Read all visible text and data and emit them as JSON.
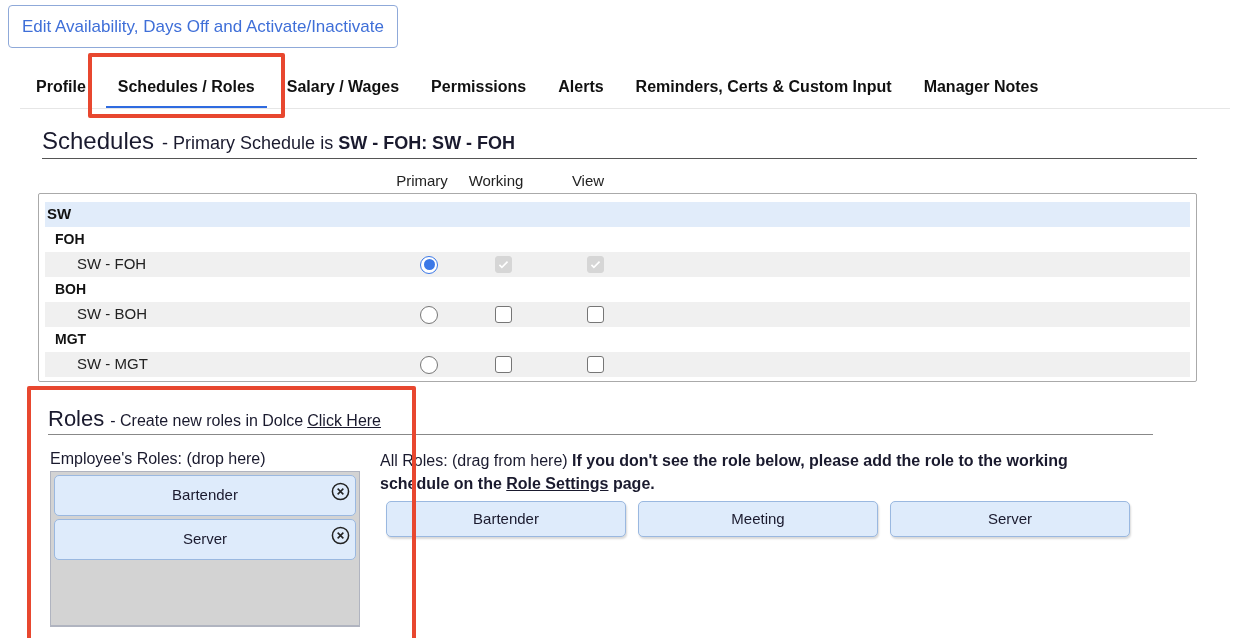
{
  "top_button": "Edit Availability, Days Off and Activate/Inactivate",
  "tabs": [
    {
      "label": "Profile",
      "selected": false,
      "highlighted": false
    },
    {
      "label": "Schedules / Roles",
      "selected": true,
      "highlighted": true
    },
    {
      "label": "Salary / Wages",
      "selected": false,
      "highlighted": false
    },
    {
      "label": "Permissions",
      "selected": false,
      "highlighted": false
    },
    {
      "label": "Alerts",
      "selected": false,
      "highlighted": false
    },
    {
      "label": "Reminders, Certs & Custom Input",
      "selected": false,
      "highlighted": false
    },
    {
      "label": "Manager Notes",
      "selected": false,
      "highlighted": false
    }
  ],
  "schedules": {
    "title": "Schedules",
    "subtitle": "- Primary Schedule is **SW - FOH: SW - FOH**",
    "columns": [
      "Primary",
      "Working",
      "View"
    ],
    "groups": [
      {
        "name": "SW",
        "children": [
          {
            "name": "FOH",
            "children": [
              {
                "name": "SW - FOH",
                "primary": true,
                "working": true,
                "view": true,
                "disabled": true
              }
            ]
          },
          {
            "name": "BOH",
            "children": [
              {
                "name": "SW - BOH",
                "primary": false,
                "working": false,
                "view": false,
                "disabled": false
              }
            ]
          },
          {
            "name": "MGT",
            "children": [
              {
                "name": "SW - MGT",
                "primary": false,
                "working": false,
                "view": false,
                "disabled": false
              }
            ]
          }
        ]
      }
    ]
  },
  "roles": {
    "highlighted": true,
    "title": "Roles",
    "subtitle": "- Create new roles in Dolce",
    "link": "Click Here",
    "employee_label": "Employee's Roles: (drop here)",
    "employee_roles": [
      "Bartender",
      "Server"
    ],
    "note_before": "All Roles: (drag from here) **If you don't see the role below, please add the role to the working schedule on the**",
    "note_link": "Role Settings",
    "note_after": "**page.**",
    "all_roles": [
      "Bartender",
      "Meeting",
      "Server"
    ]
  }
}
